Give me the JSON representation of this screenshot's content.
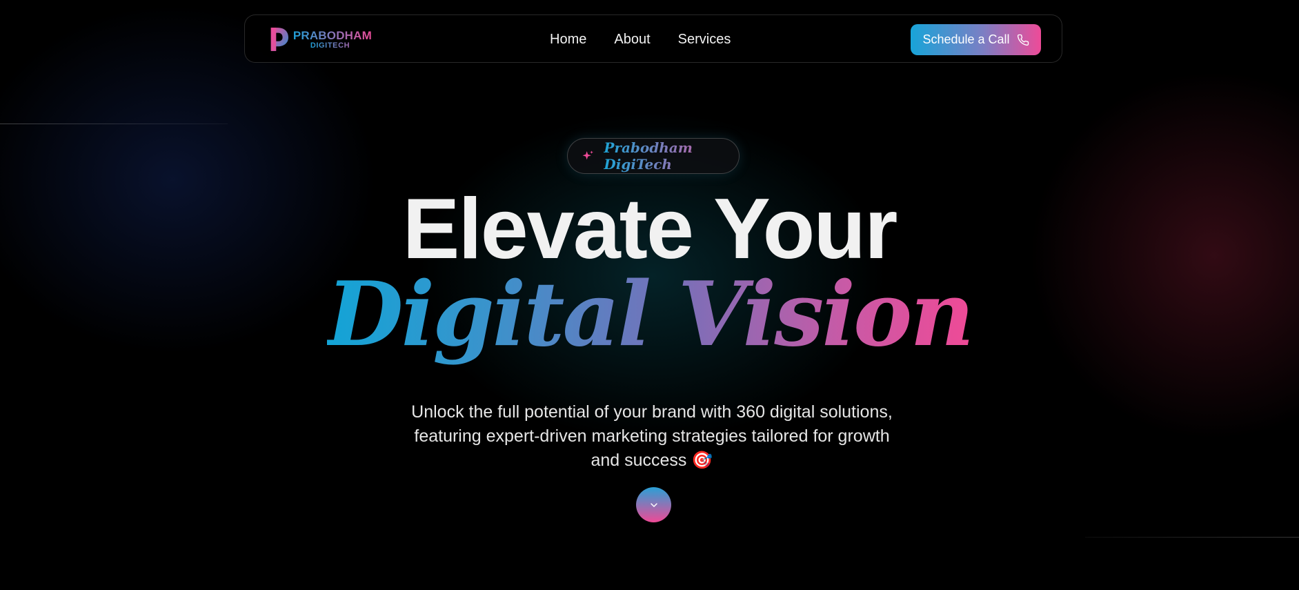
{
  "brand": {
    "name_line1": "PRABODHAM",
    "name_line2": "DIGITECH",
    "gradient_start": "#1e9fd6",
    "gradient_end": "#ec4c9a"
  },
  "nav": {
    "links": [
      {
        "label": "Home"
      },
      {
        "label": "About"
      },
      {
        "label": "Services"
      }
    ],
    "cta_label": "Schedule a Call",
    "cta_icon": "phone-icon"
  },
  "hero": {
    "badge_icon": "sparkle-icon",
    "badge_text": "Prabodham DigiTech",
    "headline_line1": "Elevate Your",
    "headline_line2": "Digital Vision",
    "subtitle": "Unlock the full potential of your brand with 360 digital solutions, featuring expert-driven marketing strategies tailored for growth and success 🎯",
    "scroll_icon": "chevron-down-icon"
  },
  "colors": {
    "background": "#000000",
    "accent_blue": "#18a4d8",
    "accent_pink": "#ee4b98"
  }
}
